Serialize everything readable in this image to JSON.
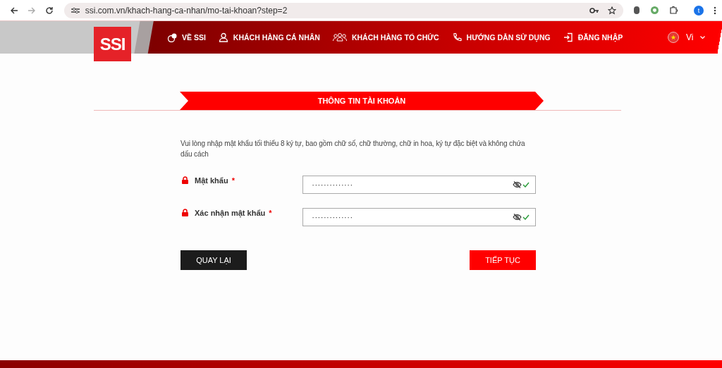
{
  "browser": {
    "url": "ssi.com.vn/khach-hang-ca-nhan/mo-tai-khoan?step=2",
    "profile_initial": "t"
  },
  "header": {
    "logo": "SSI",
    "nav": [
      {
        "label": "VỀ SSI",
        "kind": "about"
      },
      {
        "label": "KHÁCH HÀNG CÁ NHÂN",
        "kind": "person"
      },
      {
        "label": "KHÁCH HÀNG TỔ CHỨC",
        "kind": "group"
      },
      {
        "label": "HƯỚNG DẪN SỬ DỤNG",
        "kind": "phone"
      },
      {
        "label": "ĐĂNG NHẬP",
        "kind": "login"
      }
    ],
    "language": "Vi"
  },
  "step_banner": "THÔNG TIN TÀI KHOẢN",
  "instructions": "Vui lòng nhập mật khẩu tối thiểu 8 ký tự, bao gồm chữ số, chữ thường, chữ in hoa, ký tự đặc biệt và không chứa dấu cách",
  "fields": [
    {
      "label": "Mật khẩu",
      "required_mark": "*",
      "value": "··············",
      "valid": true
    },
    {
      "label": "Xác nhận mật khẩu",
      "required_mark": "*",
      "value": "··············",
      "valid": true
    }
  ],
  "buttons": [
    {
      "label": "QUAY LẠI",
      "kind": "back"
    },
    {
      "label": "TIẾP TỤC",
      "kind": "next"
    }
  ]
}
